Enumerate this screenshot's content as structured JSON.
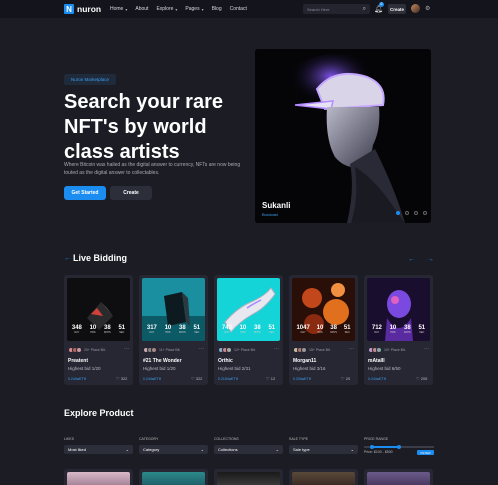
{
  "nav": {
    "logo_mark": "N",
    "logo_text": "nuron",
    "menu": [
      {
        "label": "Home",
        "chevron": true
      },
      {
        "label": "About",
        "chevron": false
      },
      {
        "label": "Explore",
        "chevron": true
      },
      {
        "label": "Pages",
        "chevron": true
      },
      {
        "label": "Blog",
        "chevron": false
      },
      {
        "label": "Contact",
        "chevron": false
      }
    ],
    "search_placeholder": "Search Here",
    "notification_count": "6",
    "create_label": "Create",
    "icons": [
      "search-icon",
      "bell-icon",
      "gear-icon"
    ]
  },
  "hero": {
    "eyebrow": "Nuron Marketplace",
    "title": "Search your rare NFT's by world class artists",
    "subtitle": "Where Bitcoin was hailed as the digital answer to currency, NFTs are now being touted as the digital answer to collectables.",
    "primary_button": "Get Started",
    "secondary_button": "Create",
    "artwork": {
      "name": "Sukanli",
      "handle": "Brodcast"
    },
    "slide_count": 4,
    "active_slide": 0
  },
  "live_bidding": {
    "title": "Live Bidding",
    "cards": [
      {
        "title": "Preatent",
        "bid": "Highest bid 1/20",
        "price": "0.244wETH",
        "likes": "322",
        "place": "20+ Place Bit.",
        "timer": [
          "348",
          "10",
          "38",
          "51"
        ]
      },
      {
        "title": "#21 The Wonder",
        "bid": "Highest bid 1/20",
        "price": "0.244wETH",
        "likes": "322",
        "place": "11+ Place Bit.",
        "timer": [
          "317",
          "10",
          "38",
          "51"
        ]
      },
      {
        "title": "Orthic",
        "bid": "Highest bid 2/31",
        "price": "0.2154wETH",
        "likes": "12",
        "place": "12+ Place Bit.",
        "timer": [
          "743",
          "10",
          "38",
          "51"
        ]
      },
      {
        "title": "Morgan11",
        "bid": "Highest bid 3/16",
        "price": "0.334wETH",
        "likes": "20",
        "place": "15+ Place Bit.",
        "timer": [
          "1047",
          "10",
          "38",
          "51"
        ]
      },
      {
        "title": "mAtalII",
        "bid": "Highest bid 6/50",
        "price": "0.244wETH",
        "likes": "205",
        "place": "10+ Place Bit.",
        "timer": [
          "712",
          "10",
          "38",
          "51"
        ]
      }
    ],
    "timer_labels": [
      "DAY",
      "HRS",
      "MIN'S",
      "SEC"
    ]
  },
  "explore": {
    "title": "Explore Product",
    "filters": [
      {
        "label": "LIKES",
        "value": "Most liked"
      },
      {
        "label": "CATEGORY",
        "value": "Category"
      },
      {
        "label": "COLLECTIONS",
        "value": "Collections"
      },
      {
        "label": "SALE TYPE",
        "value": "Sale type"
      }
    ],
    "price": {
      "label": "PRICE RANGE",
      "range": "Price: $100 - $500",
      "button": "FILTER",
      "low": 0.12,
      "high": 0.5
    }
  }
}
